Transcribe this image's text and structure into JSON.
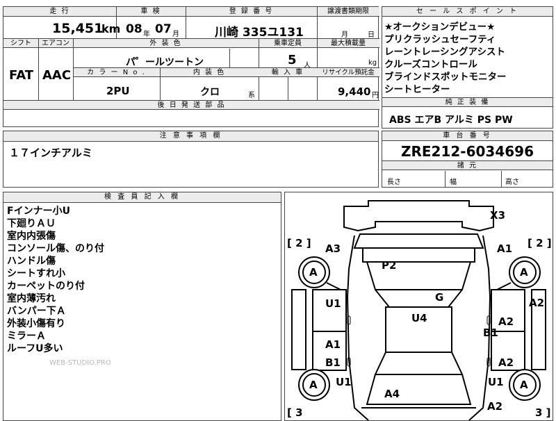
{
  "top_table": {
    "h_run": "走 行",
    "h_inspection": "車 検",
    "h_reg": "登 録 番 号",
    "h_transfer": "譲渡書類期限",
    "mileage_value": "15,451",
    "mileage_unit": "km",
    "insp_year": "08",
    "insp_year_unit": "年",
    "insp_month": "07",
    "insp_month_unit": "月",
    "reg_number": "川崎 335ユ131",
    "transfer_month_unit": "月",
    "transfer_day_unit": "日",
    "h_shift": "シフト",
    "h_aircon": "エアコン",
    "h_exterior": "外 装 色",
    "h_capacity": "乗車定員",
    "h_max_load": "最大積載量",
    "shift_value": "FAT",
    "aircon_value": "AAC",
    "exterior_value": "パ゜ールツートン",
    "capacity_value": "5",
    "capacity_unit": "人",
    "max_load_unit": "kg",
    "h_color_no": "カ ラ ー N o .",
    "h_interior": "内 装 色",
    "h_import": "輸 入 車",
    "h_recycle": "リサイクル預託金",
    "color_no_value": "2PU",
    "interior_value": "クロ",
    "interior_unit": "系",
    "recycle_value": "9,440",
    "recycle_unit": "円",
    "h_later_parts": "後 日 発 送 部 品"
  },
  "sales_points": {
    "header": "セ ー ル ス ポ イ ン ト",
    "items": [
      "★オークションデビュー★",
      "プリクラッシュセーフティ",
      "レーントレーシングアシスト",
      "クルーズコントロール",
      "ブラインドスポットモニター",
      "シートヒーター"
    ]
  },
  "equipment": {
    "header": "純 正 装 備",
    "value": "ABS エアB アルミ PS PW"
  },
  "notes": {
    "header": "注 意 事 項 欄",
    "value": "１７インチアルミ"
  },
  "chassis": {
    "header": "車 台 番 号",
    "value": "ZRE212-6034696"
  },
  "dimensions": {
    "header": "諸 元",
    "length": "長さ",
    "width": "幅",
    "height": "高さ"
  },
  "inspector": {
    "header": "検 査 員 記 入 欄",
    "lines": [
      "Fインナー小U",
      "下廻りＡＵ",
      "室内内張傷",
      "コンソール傷、のり付",
      "ハンドル傷",
      "シートすれ小",
      "カーペットのり付",
      "室内薄汚れ",
      "バンパー下Ａ",
      "外装小傷有り",
      "ミラーＡ",
      "ルーフU多い"
    ],
    "watermark": "WEB-STUDIO.PRO"
  },
  "diagram": {
    "bracket_fl": "[ 2 ]",
    "bracket_fr": "[ 2 ]",
    "bracket_rl": "[ 3",
    "bracket_rr": "3 ]",
    "wheel_label": "A",
    "codes": {
      "x3": "X3",
      "a3": "A3",
      "a1_top": "A1",
      "p2": "P2",
      "g": "G",
      "a2_right": "A2",
      "u1_left": "U1",
      "u4": "U4",
      "a2_door_r": "A2",
      "b1_right": "B1",
      "a1_left_rear": "A1",
      "b1_left": "B1",
      "a2_rear_r": "A2",
      "u1_rl": "U1",
      "u1_rr": "U1",
      "a4": "A4",
      "a2_bottom": "A2"
    }
  }
}
